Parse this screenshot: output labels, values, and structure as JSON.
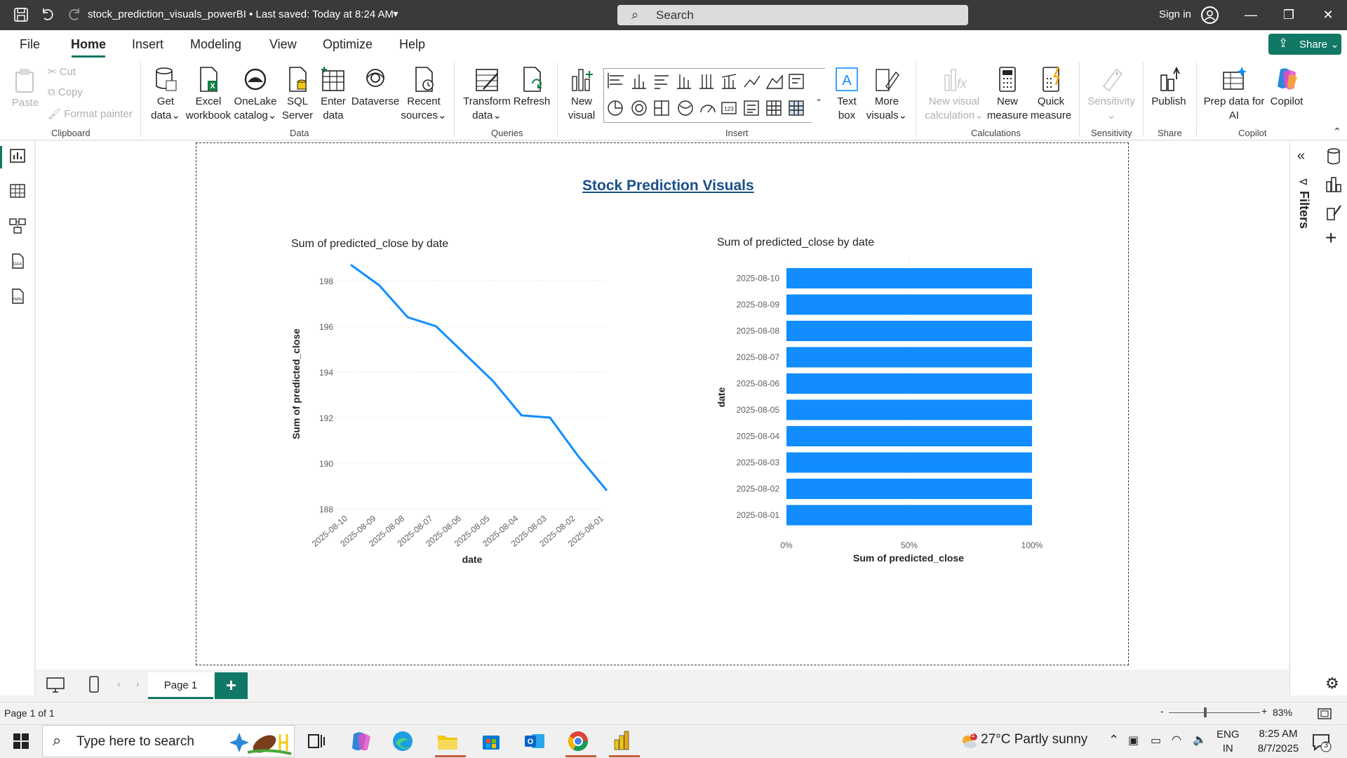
{
  "titlebar": {
    "doc_title": "stock_prediction_visuals_powerBI • Last saved: Today at 8:24 AM",
    "search_placeholder": "Search",
    "sign_in": "Sign in"
  },
  "menu": {
    "tabs": [
      "File",
      "Home",
      "Insert",
      "Modeling",
      "View",
      "Optimize",
      "Help"
    ],
    "active": "Home",
    "share_label": "Share"
  },
  "ribbon": {
    "clipboard": {
      "paste": "Paste",
      "cut": "Cut",
      "copy": "Copy",
      "format_painter": "Format painter",
      "group": "Clipboard"
    },
    "data": {
      "get_data": [
        "Get",
        "data"
      ],
      "excel": [
        "Excel",
        "workbook"
      ],
      "onelake": [
        "OneLake",
        "catalog"
      ],
      "sql": [
        "SQL",
        "Server"
      ],
      "enter_data": [
        "Enter",
        "data"
      ],
      "dataverse": [
        "Dataverse"
      ],
      "recent": [
        "Recent",
        "sources"
      ],
      "group": "Data"
    },
    "queries": {
      "transform": [
        "Transform",
        "data"
      ],
      "refresh": "Refresh",
      "group": "Queries"
    },
    "insert": {
      "new_visual": [
        "New",
        "visual"
      ],
      "text_box": [
        "Text",
        "box"
      ],
      "more_visuals": [
        "More",
        "visuals"
      ],
      "group": "Insert"
    },
    "calculations": {
      "new_visual_calc": [
        "New visual",
        "calculation"
      ],
      "new_measure": [
        "New",
        "measure"
      ],
      "quick_measure": [
        "Quick",
        "measure"
      ],
      "group": "Calculations"
    },
    "sensitivity": {
      "label": "Sensitivity",
      "group": "Sensitivity"
    },
    "share": {
      "publish": "Publish",
      "group": "Share"
    },
    "copilot": {
      "prep": [
        "Prep data for",
        "AI"
      ],
      "copilot": "Copilot",
      "group": "Copilot"
    }
  },
  "report": {
    "title": "Stock Prediction Visuals"
  },
  "chart_data": [
    {
      "type": "line",
      "title": "Sum of predicted_close by date",
      "xlabel": "date",
      "ylabel": "Sum of predicted_close",
      "categories": [
        "2025-08-10",
        "2025-08-09",
        "2025-08-08",
        "2025-08-07",
        "2025-08-06",
        "2025-08-05",
        "2025-08-04",
        "2025-08-03",
        "2025-08-02",
        "2025-08-01"
      ],
      "values": [
        198.7,
        197.8,
        196.4,
        196.0,
        194.8,
        193.6,
        192.1,
        192.0,
        190.3,
        188.8
      ],
      "ylim": [
        188,
        198
      ],
      "yticks": [
        188,
        190,
        192,
        194,
        196,
        198
      ],
      "grid": true,
      "color": "#118dff"
    },
    {
      "type": "bar",
      "orientation": "horizontal",
      "title": "Sum of predicted_close by date",
      "xlabel": "Sum of predicted_close",
      "ylabel": "date",
      "categories": [
        "2025-08-10",
        "2025-08-09",
        "2025-08-08",
        "2025-08-07",
        "2025-08-06",
        "2025-08-05",
        "2025-08-04",
        "2025-08-03",
        "2025-08-02",
        "2025-08-01"
      ],
      "values": [
        100,
        100,
        100,
        100,
        100,
        100,
        100,
        100,
        100,
        100
      ],
      "xlim": [
        0,
        100
      ],
      "xticks": [
        "0%",
        "50%",
        "100%"
      ],
      "color": "#118dff"
    }
  ],
  "pages": {
    "tab_label": "Page 1",
    "add": "+"
  },
  "status": {
    "page": "Page 1 of 1",
    "zoom": "83%",
    "zoom_minus": "-",
    "zoom_plus": "+"
  },
  "right_pane": {
    "filters": "Filters"
  },
  "taskbar": {
    "search_placeholder": "Type here to search",
    "weather": "27°C  Partly sunny",
    "weather_badge": "1",
    "lang": [
      "ENG",
      "IN"
    ],
    "time": "8:25 AM",
    "date": "8/7/2025",
    "notifications": "3"
  }
}
